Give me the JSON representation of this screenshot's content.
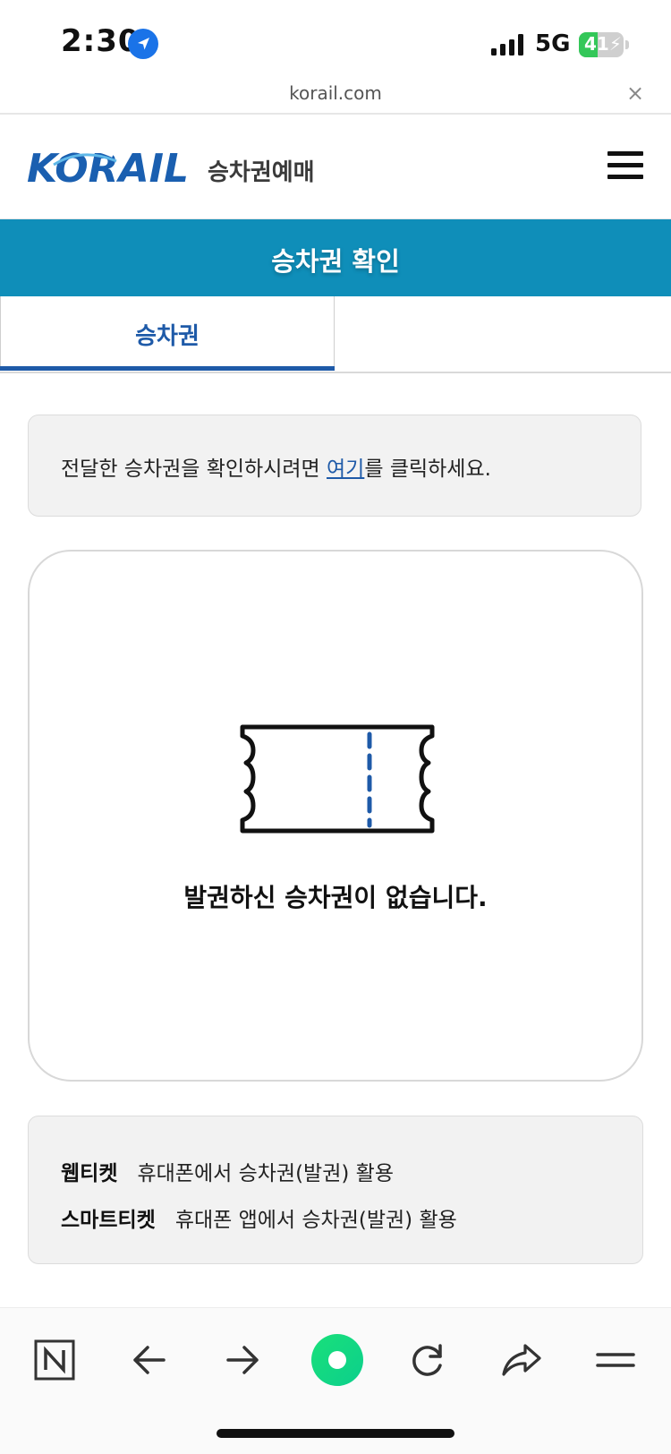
{
  "status_bar": {
    "time": "2:30",
    "network": "5G",
    "battery_level": "41",
    "battery_fraction": 0.41
  },
  "browser": {
    "url": "korail.com",
    "close_label": "×"
  },
  "header": {
    "logo_text": "KORAIL",
    "subtitle": "승차권예매"
  },
  "page_title": "승차권 확인",
  "tabs": [
    {
      "label": "승차권",
      "active": true
    },
    {
      "label": "",
      "active": false
    }
  ],
  "notice": {
    "before": "전달한 승차권을 확인하시려면 ",
    "link": "여기",
    "after": "를 클릭하세요."
  },
  "ticket_card": {
    "empty_message": "발권하신 승차권이 없습니다."
  },
  "info": [
    {
      "key": "웹티켓",
      "value": "휴대폰에서 승차권(발권) 활용"
    },
    {
      "key": "스마트티켓",
      "value": "휴대폰 앱에서 승차권(발권) 활용"
    }
  ],
  "toolbar_icons": [
    "naver-n-icon",
    "back-arrow-icon",
    "forward-arrow-icon",
    "green-home-icon",
    "reload-icon",
    "share-icon",
    "menu-icon"
  ],
  "colors": {
    "title_bar": "#0f8eb9",
    "active_tab": "#1e5aa8",
    "brand_blue": "#1a5fb0"
  }
}
